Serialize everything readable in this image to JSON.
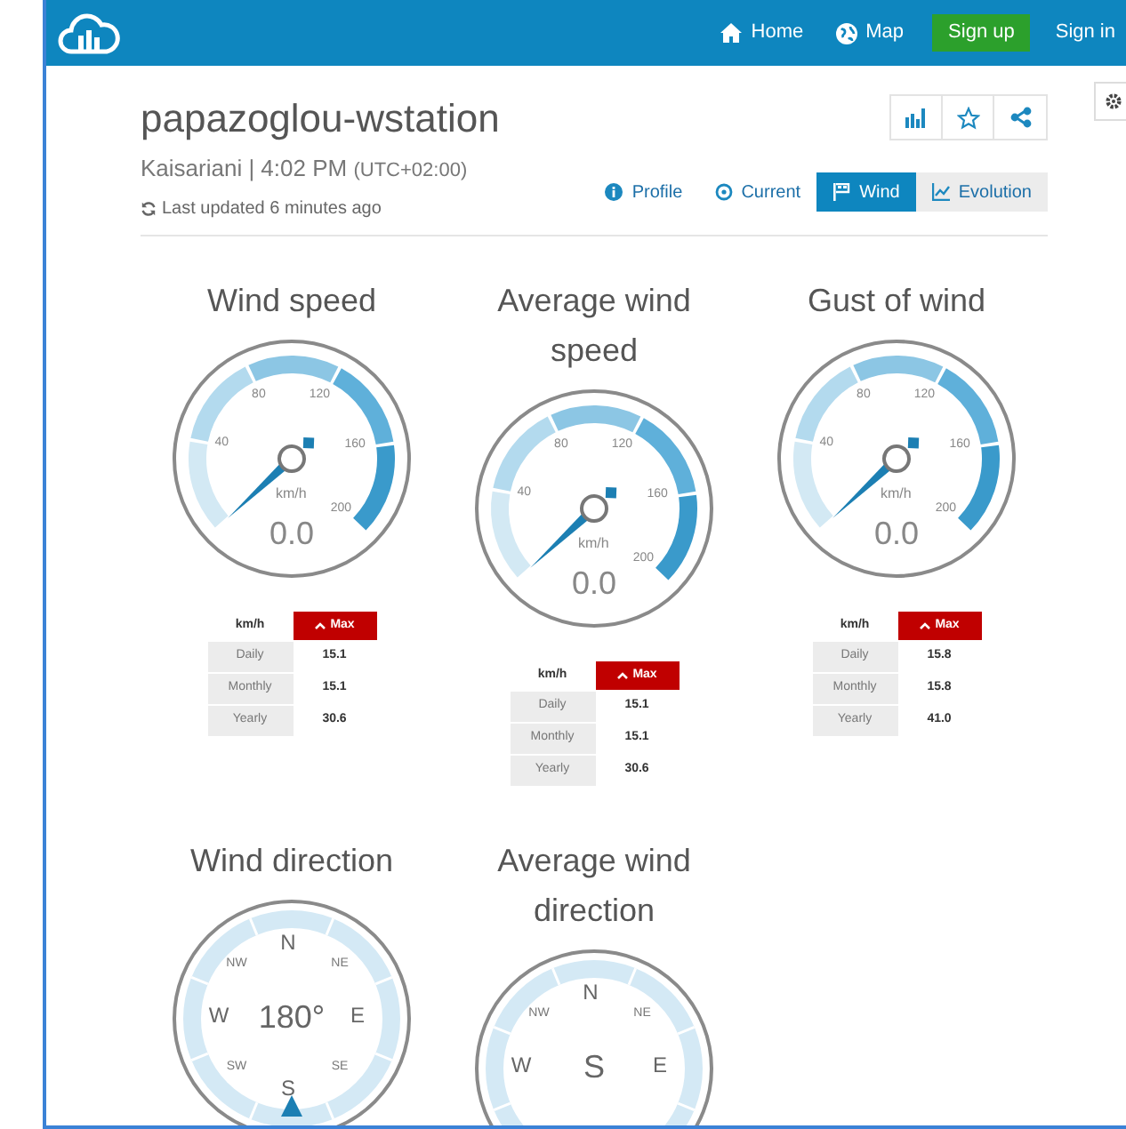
{
  "nav": [
    {
      "kind": "home",
      "label": "Home"
    },
    {
      "kind": "map",
      "label": "Map"
    },
    {
      "kind": "signup",
      "label": "Sign up"
    },
    {
      "kind": "signin",
      "label": "Sign in"
    }
  ],
  "station": {
    "name": "papazoglou-wstation",
    "location": "Kaisariani | 4:02 PM",
    "timezone": "(UTC+02:00)",
    "updated": "Last updated 6 minutes ago"
  },
  "tabs": [
    {
      "kind": "profile",
      "label": "Profile",
      "selected": false
    },
    {
      "kind": "current",
      "label": "Current",
      "selected": false
    },
    {
      "kind": "wind",
      "label": "Wind",
      "selected": true
    },
    {
      "kind": "evolution",
      "label": "Evolution",
      "selected": false
    }
  ],
  "gauges": [
    {
      "title": "Wind speed",
      "ticks": [
        "40",
        "80",
        "120",
        "160",
        "200"
      ],
      "unit": "km/h",
      "value": "0.0",
      "table": {
        "unit": "km/h",
        "button": "Max",
        "rows": [
          {
            "label": "Daily",
            "value": "15.1"
          },
          {
            "label": "Monthly",
            "value": "15.1"
          },
          {
            "label": "Yearly",
            "value": "30.6"
          }
        ]
      }
    },
    {
      "title": "Average wind speed",
      "ticks": [
        "40",
        "80",
        "120",
        "160",
        "200"
      ],
      "unit": "km/h",
      "value": "0.0",
      "table": {
        "unit": "km/h",
        "button": "Max",
        "rows": [
          {
            "label": "Daily",
            "value": "15.1"
          },
          {
            "label": "Monthly",
            "value": "15.1"
          },
          {
            "label": "Yearly",
            "value": "30.6"
          }
        ]
      }
    },
    {
      "title": "Gust of wind",
      "ticks": [
        "40",
        "80",
        "120",
        "160",
        "200"
      ],
      "unit": "km/h",
      "value": "0.0",
      "table": {
        "unit": "km/h",
        "button": "Max",
        "rows": [
          {
            "label": "Daily",
            "value": "15.8"
          },
          {
            "label": "Monthly",
            "value": "15.8"
          },
          {
            "label": "Yearly",
            "value": "41.0"
          }
        ]
      }
    }
  ],
  "compasses": [
    {
      "title": "Wind direction",
      "center": "180°",
      "pointer": true,
      "points": {
        "n": "N",
        "ne": "NE",
        "e": "E",
        "se": "SE",
        "s": "S",
        "sw": "SW",
        "w": "W",
        "nw": "NW"
      }
    },
    {
      "title": "Average wind direction",
      "center": "S",
      "pointer": false,
      "points": {
        "n": "N",
        "ne": "NE",
        "e": "E",
        "w": "W",
        "nw": "NW"
      }
    }
  ]
}
